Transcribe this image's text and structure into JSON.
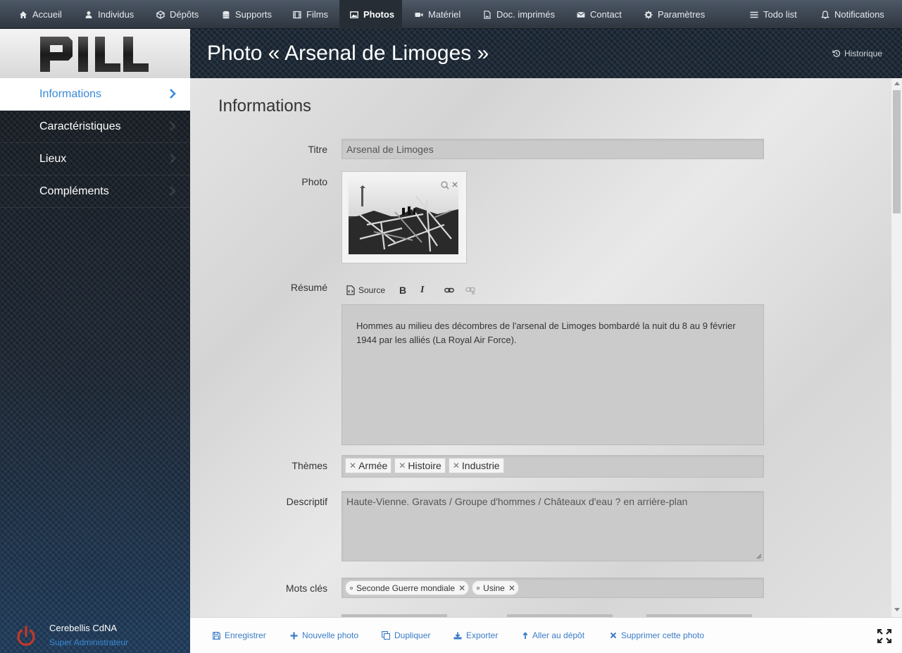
{
  "nav": {
    "items": [
      {
        "label": "Accueil",
        "icon": "home-icon"
      },
      {
        "label": "Individus",
        "icon": "user-icon"
      },
      {
        "label": "Dépôts",
        "icon": "cube-icon"
      },
      {
        "label": "Supports",
        "icon": "database-icon"
      },
      {
        "label": "Films",
        "icon": "film-icon"
      },
      {
        "label": "Photos",
        "icon": "image-icon",
        "active": true
      },
      {
        "label": "Matériel",
        "icon": "video-camera-icon"
      },
      {
        "label": "Doc. imprimés",
        "icon": "document-image-icon"
      },
      {
        "label": "Contact",
        "icon": "envelope-icon"
      },
      {
        "label": "Paramètres",
        "icon": "gear-icon"
      }
    ],
    "todo": "Todo list",
    "notifications": "Notifications"
  },
  "logo": "PILL",
  "sidebar": {
    "items": [
      {
        "label": "Informations",
        "active": true
      },
      {
        "label": "Caractéristiques"
      },
      {
        "label": "Lieux"
      },
      {
        "label": "Compléments"
      }
    ]
  },
  "user": {
    "name": "Cerebellis CdNA",
    "role": "Super Administrateur"
  },
  "header": {
    "title": "Photo « Arsenal de Limoges »",
    "history": "Historique"
  },
  "section": {
    "title": "Informations"
  },
  "form": {
    "titre_label": "Titre",
    "titre_value": "Arsenal de Limoges",
    "photo_label": "Photo",
    "resume_label": "Résumé",
    "editor_source": "Source",
    "resume_text": "Hommes au milieu des décombres de l'arsenal de Limoges bombardé la nuit du 8 au 9 février 1944 par les alliés (La Royal Air Force).",
    "themes_label": "Thèmes",
    "themes": [
      "Armée",
      "Histoire",
      "Industrie"
    ],
    "descriptif_label": "Descriptif",
    "descriptif_value": "Haute-Vienne. Gravats / Groupe d'hommes / Châteaux d'eau ? en arrière-plan",
    "motscles_label": "Mots clés",
    "motscles": [
      "Seconde Guerre mondiale",
      "Usine"
    ]
  },
  "actions": {
    "save": "Enregistrer",
    "new_photo": "Nouvelle photo",
    "duplicate": "Dupliquer",
    "export": "Exporter",
    "goto_depot": "Aller au dépôt",
    "delete": "Supprimer cette photo"
  },
  "colors": {
    "accent": "#3a8ad6",
    "link": "#3a7bc8",
    "power": "#c0392b"
  }
}
